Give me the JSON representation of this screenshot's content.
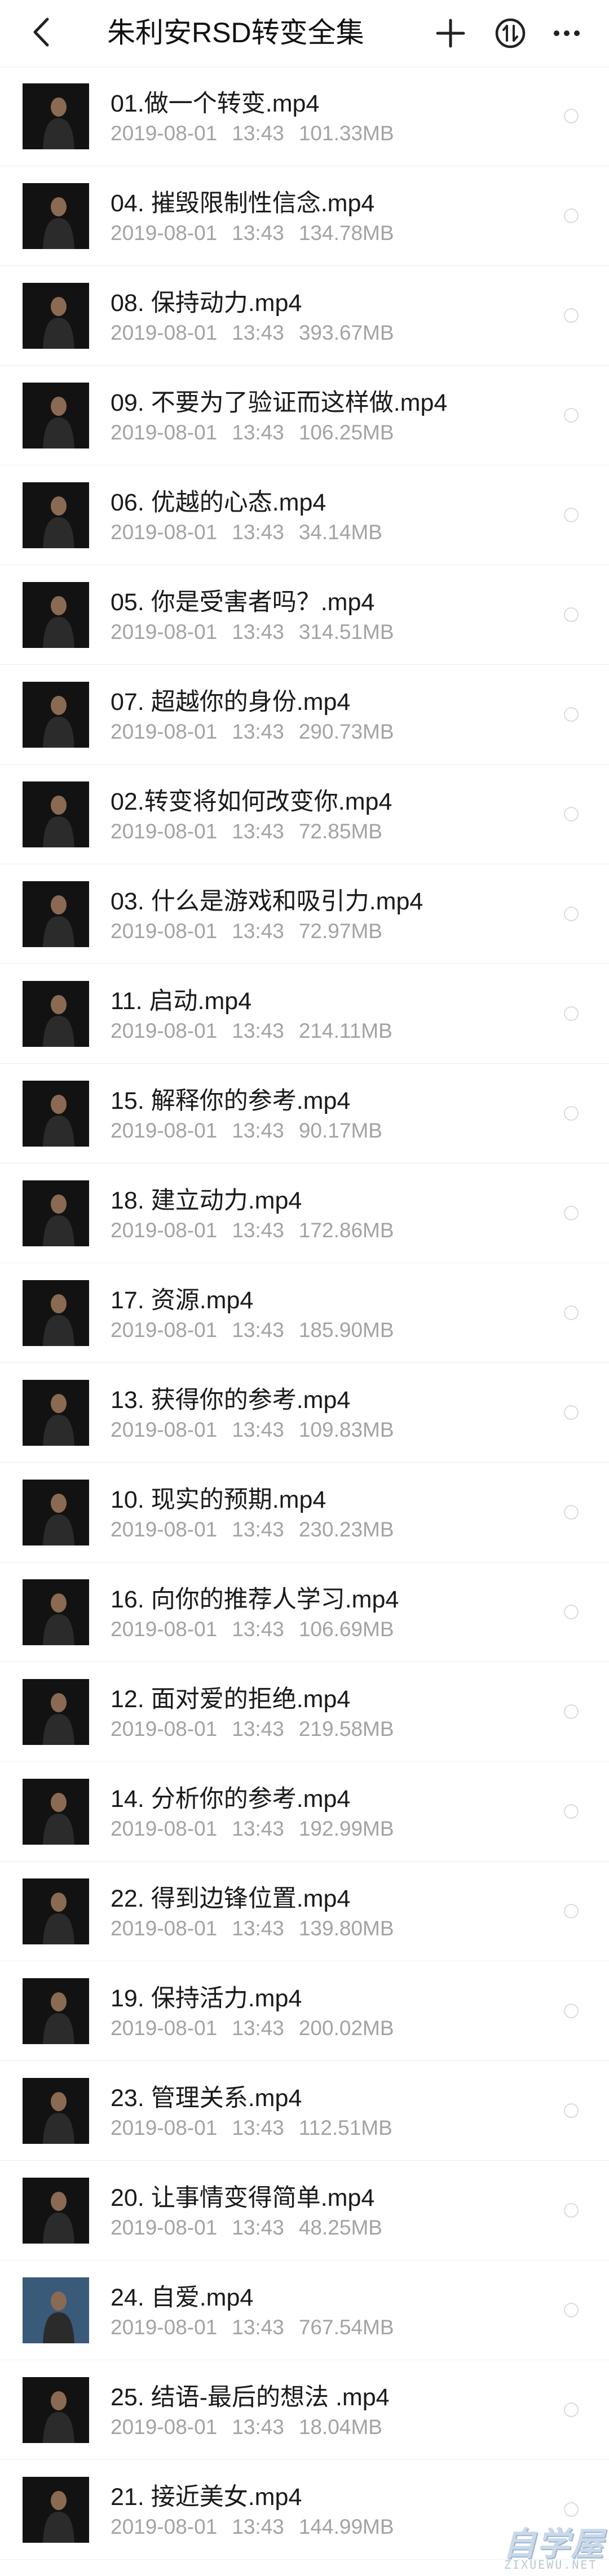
{
  "header": {
    "title": "朱利安RSD转变全集",
    "icons": [
      "back-icon",
      "plus-icon",
      "sort-icon",
      "more-icon"
    ]
  },
  "files": [
    {
      "name": "01.做一个转变.mp4",
      "date": "2019-08-01",
      "time": "13:43",
      "size": "101.33MB"
    },
    {
      "name": "04. 摧毁限制性信念.mp4",
      "date": "2019-08-01",
      "time": "13:43",
      "size": "134.78MB"
    },
    {
      "name": "08. 保持动力.mp4",
      "date": "2019-08-01",
      "time": "13:43",
      "size": "393.67MB"
    },
    {
      "name": "09. 不要为了验证而这样做.mp4",
      "date": "2019-08-01",
      "time": "13:43",
      "size": "106.25MB"
    },
    {
      "name": "06. 优越的心态.mp4",
      "date": "2019-08-01",
      "time": "13:43",
      "size": "34.14MB"
    },
    {
      "name": "05. 你是受害者吗？.mp4",
      "date": "2019-08-01",
      "time": "13:43",
      "size": "314.51MB"
    },
    {
      "name": "07. 超越你的身份.mp4",
      "date": "2019-08-01",
      "time": "13:43",
      "size": "290.73MB"
    },
    {
      "name": "02.转变将如何改变你.mp4",
      "date": "2019-08-01",
      "time": "13:43",
      "size": "72.85MB"
    },
    {
      "name": "03. 什么是游戏和吸引力.mp4",
      "date": "2019-08-01",
      "time": "13:43",
      "size": "72.97MB"
    },
    {
      "name": "11. 启动.mp4",
      "date": "2019-08-01",
      "time": "13:43",
      "size": "214.11MB"
    },
    {
      "name": "15. 解释你的参考.mp4",
      "date": "2019-08-01",
      "time": "13:43",
      "size": "90.17MB"
    },
    {
      "name": "18. 建立动力.mp4",
      "date": "2019-08-01",
      "time": "13:43",
      "size": "172.86MB"
    },
    {
      "name": "17. 资源.mp4",
      "date": "2019-08-01",
      "time": "13:43",
      "size": "185.90MB"
    },
    {
      "name": "13. 获得你的参考.mp4",
      "date": "2019-08-01",
      "time": "13:43",
      "size": "109.83MB"
    },
    {
      "name": "10. 现实的预期.mp4",
      "date": "2019-08-01",
      "time": "13:43",
      "size": "230.23MB"
    },
    {
      "name": "16. 向你的推荐人学习.mp4",
      "date": "2019-08-01",
      "time": "13:43",
      "size": "106.69MB"
    },
    {
      "name": "12. 面对爱的拒绝.mp4",
      "date": "2019-08-01",
      "time": "13:43",
      "size": "219.58MB"
    },
    {
      "name": "14. 分析你的参考.mp4",
      "date": "2019-08-01",
      "time": "13:43",
      "size": "192.99MB"
    },
    {
      "name": "22. 得到边锋位置.mp4",
      "date": "2019-08-01",
      "time": "13:43",
      "size": "139.80MB"
    },
    {
      "name": "19. 保持活力.mp4",
      "date": "2019-08-01",
      "time": "13:43",
      "size": "200.02MB"
    },
    {
      "name": "23. 管理关系.mp4",
      "date": "2019-08-01",
      "time": "13:43",
      "size": "112.51MB"
    },
    {
      "name": "20. 让事情变得简单.mp4",
      "date": "2019-08-01",
      "time": "13:43",
      "size": "48.25MB"
    },
    {
      "name": "24. 自爱.mp4",
      "date": "2019-08-01",
      "time": "13:43",
      "size": "767.54MB"
    },
    {
      "name": "25. 结语-最后的想法 .mp4",
      "date": "2019-08-01",
      "time": "13:43",
      "size": "18.04MB"
    },
    {
      "name": "21. 接近美女.mp4",
      "date": "2019-08-01",
      "time": "13:43",
      "size": "144.99MB"
    }
  ],
  "watermark": {
    "main": "自学屋",
    "sub": "ZIXUEWU.NET"
  },
  "colors": {
    "thumbnail_bg": "#121212",
    "thumbnail_special": "#3a5a7a",
    "radio_border": "#dcdcdc",
    "meta_text": "#a3a3a3"
  }
}
